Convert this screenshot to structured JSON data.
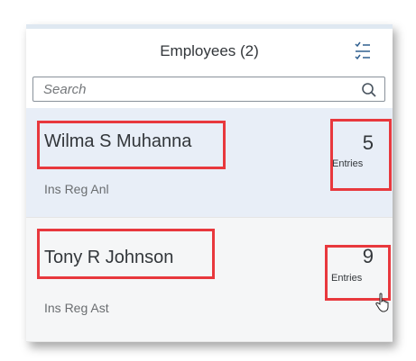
{
  "header": {
    "title": "Employees (2)",
    "filter_icon": "sort-filter-icon"
  },
  "search": {
    "placeholder": "Search",
    "value": "",
    "icon": "magnifier-icon"
  },
  "employees": [
    {
      "name": "Wilma S Muhanna",
      "role": "Ins Reg Anl",
      "count": "5",
      "count_label": "Entries",
      "selected": true
    },
    {
      "name": "Tony R Johnson",
      "role": "Ins Reg Ast",
      "count": "9",
      "count_label": "Entries",
      "selected": false
    }
  ],
  "colors": {
    "highlight": "#e8383d",
    "selected_row": "#e8eef7",
    "row": "#f5f6f7",
    "text": "#32363a"
  }
}
